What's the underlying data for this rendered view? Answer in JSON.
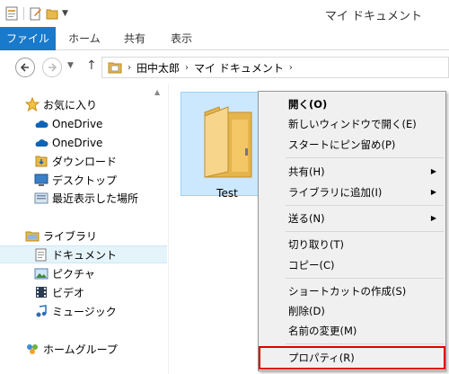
{
  "window": {
    "title": "マイ ドキュメント"
  },
  "ribbon": {
    "tabs": [
      "ファイル",
      "ホーム",
      "共有",
      "表示"
    ]
  },
  "address": {
    "crumbs": [
      "田中太郎",
      "マイ ドキュメント"
    ]
  },
  "sidebar": {
    "favorites_label": "お気に入り",
    "favorites": [
      "OneDrive",
      "OneDrive",
      "ダウンロード",
      "デスクトップ",
      "最近表示した場所"
    ],
    "library_label": "ライブラリ",
    "libraries": [
      "ドキュメント",
      "ピクチャ",
      "ビデオ",
      "ミュージック"
    ],
    "homegroup_label": "ホームグループ"
  },
  "main": {
    "folder_name": "Test"
  },
  "context_menu": {
    "items": [
      {
        "label": "開く(O)",
        "bold": true
      },
      {
        "label": "新しいウィンドウで開く(E)"
      },
      {
        "label": "スタートにピン留め(P)"
      },
      {
        "label": "共有(H)",
        "submenu": true
      },
      {
        "label": "ライブラリに追加(I)",
        "submenu": true
      },
      {
        "label": "送る(N)",
        "submenu": true
      },
      {
        "label": "切り取り(T)"
      },
      {
        "label": "コピー(C)"
      },
      {
        "label": "ショートカットの作成(S)"
      },
      {
        "label": "削除(D)"
      },
      {
        "label": "名前の変更(M)"
      },
      {
        "label": "プロパティ(R)",
        "highlighted": true
      }
    ]
  },
  "colors": {
    "accent": "#1979ca",
    "selection": "#cce8ff",
    "highlight_box": "#e00000"
  }
}
